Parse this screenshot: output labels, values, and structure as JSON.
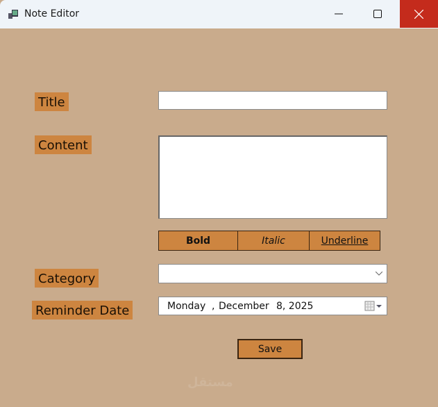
{
  "window": {
    "title": "Note Editor",
    "accent": "#c42b1c"
  },
  "form": {
    "title_label": "Title",
    "title_value": "",
    "content_label": "Content",
    "content_value": "",
    "bold_label": "Bold",
    "italic_label": "Italic",
    "underline_label": "Underline",
    "category_label": "Category",
    "category_value": "",
    "reminder_label": "Reminder Date",
    "date_day": "Monday",
    "date_month": "December",
    "date_daynum_year": "8, 2025",
    "save_label": "Save"
  },
  "watermark": "مستقل mostaql.com"
}
